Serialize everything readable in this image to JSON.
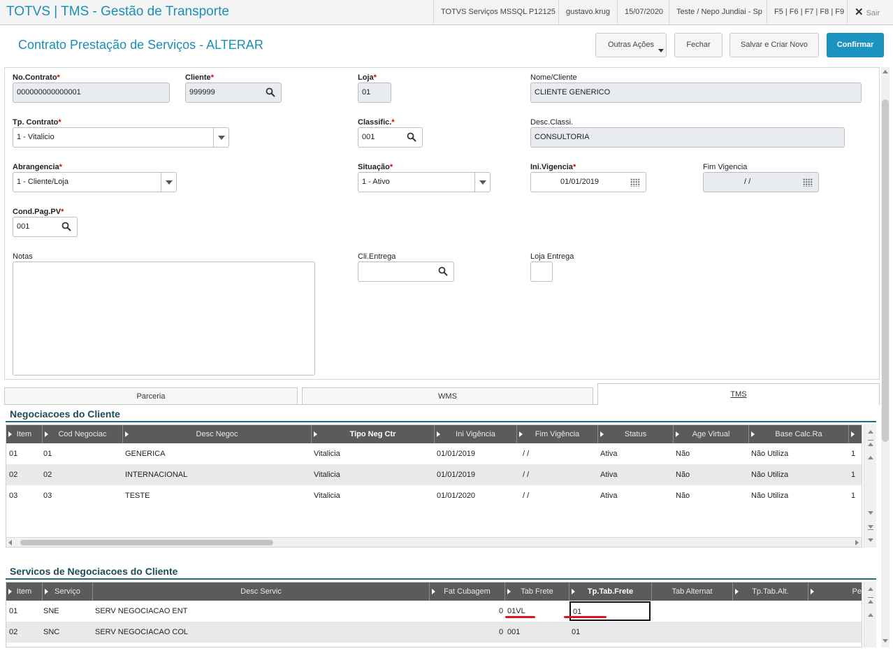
{
  "topbar": {
    "title": "TOTVS | TMS - Gestão de Transporte",
    "server": "TOTVS Serviços MSSQL P12125",
    "user": "gustavo.krug",
    "date": "15/07/2020",
    "branch": "Teste / Nepo Jundiai - Sp",
    "shortcuts": "F5 | F6 | F7 | F8 | F9",
    "exit_label": "Sair"
  },
  "header": {
    "title": "Contrato Prestação de Serviços - ALTERAR",
    "other_actions": "Outras Ações",
    "close": "Fechar",
    "save_new": "Salvar e Criar Novo",
    "confirm": "Confirmar"
  },
  "form": {
    "no_contrato": {
      "label": "No.Contrato",
      "value": "000000000000001"
    },
    "cliente": {
      "label": "Cliente",
      "value": "999999"
    },
    "loja": {
      "label": "Loja",
      "value": "01"
    },
    "nome_cliente": {
      "label": "Nome/Cliente",
      "value": "CLIENTE GENERICO"
    },
    "tp_contrato": {
      "label": "Tp. Contrato",
      "value": "1 - Vitalicio"
    },
    "classific": {
      "label": "Classific.",
      "value": "001"
    },
    "desc_classi": {
      "label": "Desc.Classi.",
      "value": "CONSULTORIA"
    },
    "abrangencia": {
      "label": "Abrangencia",
      "value": "1 - Cliente/Loja"
    },
    "situacao": {
      "label": "Situação",
      "value": "1 - Ativo"
    },
    "ini_vigencia": {
      "label": "Ini.Vigencia",
      "value": "01/01/2019"
    },
    "fim_vigencia": {
      "label": "Fim Vigencia",
      "value": "/  /"
    },
    "cond_pag": {
      "label": "Cond.Pag.PV",
      "value": "001"
    },
    "notas": {
      "label": "Notas"
    },
    "cli_entrega": {
      "label": "Cli.Entrega",
      "value": ""
    },
    "loja_entrega": {
      "label": "Loja Entrega",
      "value": ""
    },
    "required_mark": "*"
  },
  "tabs": {
    "parceria": "Parceria",
    "wms": "WMS",
    "tms": "TMS"
  },
  "negociacoes": {
    "title": "Negociacoes do Cliente",
    "headers": [
      "Item",
      "Cod Negociac",
      "Desc Negoc",
      "Tipo Neg Ctr",
      "Ini Vigência",
      "Fim Vigência",
      "Status",
      "Age Virtual",
      "Base Calc.Ra",
      ""
    ],
    "rows": [
      [
        "01",
        "01",
        "GENERICA",
        "Vitalicia",
        "01/01/2019",
        "/  /",
        "Ativa",
        "Não",
        "Não Utiliza",
        "1"
      ],
      [
        "02",
        "02",
        "INTERNACIONAL",
        "Vitalicia",
        "01/01/2019",
        "/  /",
        "Ativa",
        "Não",
        "Não Utiliza",
        "1"
      ],
      [
        "03",
        "03",
        "TESTE",
        "Vitalicia",
        "01/01/2020",
        "/  /",
        "Ativa",
        "Não",
        "Não Utiliza",
        "1"
      ]
    ]
  },
  "servicos": {
    "title": "Servicos de Negociacoes do Cliente",
    "headers": [
      "Item",
      "Serviço",
      "Desc Servic",
      "Fat Cubagem",
      "Tab Frete",
      "Tp.Tab.Frete",
      "Tab Alternat",
      "Tp.Tab.Alt.",
      "Pe"
    ],
    "rows": [
      [
        "01",
        "SNE",
        "SERV NEGOCIACAO ENT",
        "0",
        "01VL",
        "01",
        "",
        "",
        ""
      ],
      [
        "02",
        "SNC",
        "SERV NEGOCIACAO COL",
        "0",
        "001",
        "01",
        "",
        "",
        ""
      ]
    ]
  },
  "colors": {
    "accent": "#1a8fb7",
    "primary_button": "#1b94c2",
    "grid_header": "#5b5b5b",
    "required": "#dd0000",
    "annotation": "#e0141e"
  }
}
